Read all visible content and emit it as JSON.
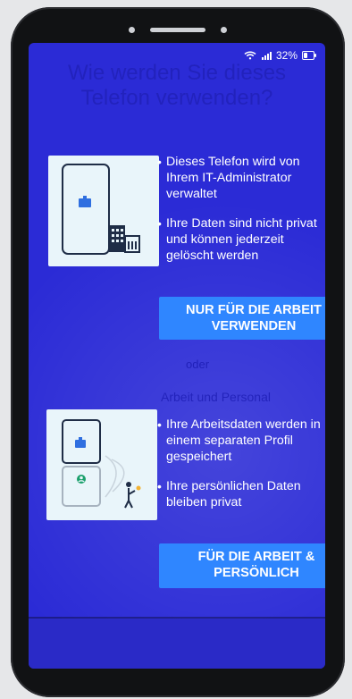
{
  "status_bar": {
    "battery_percent": "32%",
    "icons": [
      "wifi-icon",
      "signal-icon",
      "battery-icon"
    ]
  },
  "title": "Wie werden Sie dieses Telefon verwenden?",
  "option_work_only": {
    "bullets": [
      "Dieses Telefon wird von Ihrem IT-Administrator verwaltet",
      "Ihre Daten sind nicht privat und können jederzeit gelöscht werden"
    ],
    "button_label": "NUR FÜR DIE ARBEIT VERWENDEN"
  },
  "divider_text": "oder",
  "option_work_personal": {
    "section_label": "Arbeit und Personal",
    "bullets": [
      "Ihre Arbeitsdaten werden in einem separaten Profil gespeichert",
      "Ihre persönlichen Daten bleiben privat"
    ],
    "button_label": "FÜR DIE ARBEIT & PERSÖNLICH"
  },
  "colors": {
    "screen_background": "#2b2bd6",
    "button_background": "#2f86ff",
    "illustration_background": "#e9f5fa"
  }
}
